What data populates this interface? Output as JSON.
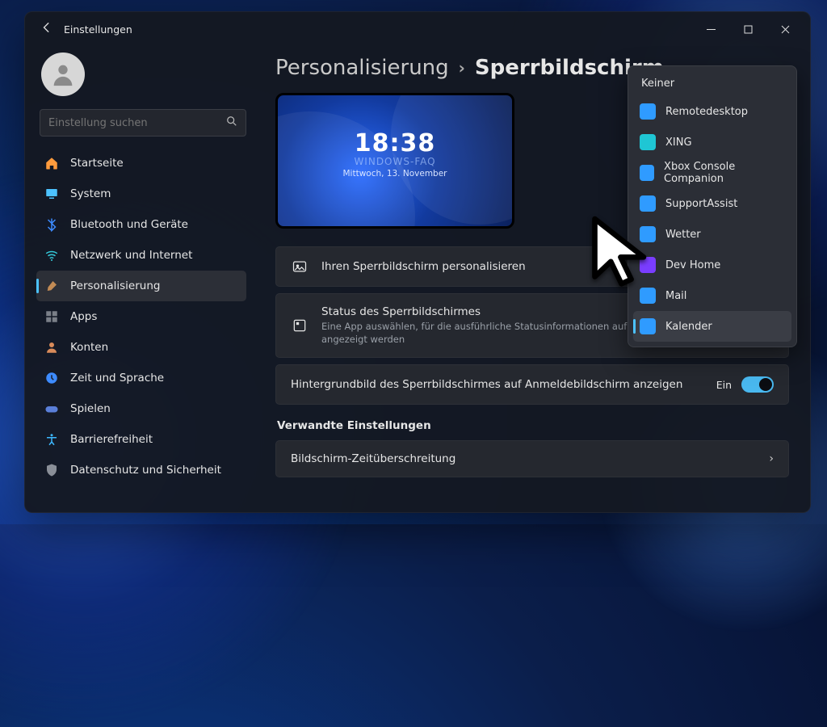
{
  "window": {
    "title": "Einstellungen"
  },
  "search": {
    "placeholder": "Einstellung suchen"
  },
  "nav": {
    "items": [
      {
        "label": "Startseite",
        "icon": "home",
        "color": "#ff9b3d"
      },
      {
        "label": "System",
        "icon": "system",
        "color": "#4cc2ff"
      },
      {
        "label": "Bluetooth und Geräte",
        "icon": "bluetooth",
        "color": "#3d8bff"
      },
      {
        "label": "Netzwerk und Internet",
        "icon": "wifi",
        "color": "#35c8d9"
      },
      {
        "label": "Personalisierung",
        "icon": "brush",
        "color": "#c28b55",
        "selected": true
      },
      {
        "label": "Apps",
        "icon": "apps",
        "color": "#7a7f88"
      },
      {
        "label": "Konten",
        "icon": "account",
        "color": "#d98b5a"
      },
      {
        "label": "Zeit und Sprache",
        "icon": "time",
        "color": "#3d8bff"
      },
      {
        "label": "Spielen",
        "icon": "game",
        "color": "#5a7fd9"
      },
      {
        "label": "Barrierefreiheit",
        "icon": "a11y",
        "color": "#3db8ff"
      },
      {
        "label": "Datenschutz und Sicherheit",
        "icon": "shield",
        "color": "#8a8f98"
      }
    ]
  },
  "breadcrumb": {
    "parent": "Personalisierung",
    "current": "Sperrbildschirm"
  },
  "preview": {
    "time": "18:38",
    "watermark": "WINDOWS-FAQ",
    "date": "Mittwoch, 13. November"
  },
  "cards": {
    "personalize": {
      "title": "Ihren Sperrbildschirm personalisieren"
    },
    "status": {
      "title": "Status des Sperrbildschirmes",
      "desc": "Eine App auswählen, für die ausführliche Statusinformationen auf dem Sperrbildschirm angezeigt werden"
    },
    "background_toggle": {
      "title": "Hintergrundbild des Sperrbildschirmes auf Anmeldebildschirm anzeigen",
      "state_label": "Ein",
      "state": true
    }
  },
  "related": {
    "heading": "Verwandte Einstellungen",
    "timeout": {
      "title": "Bildschirm-Zeitüberschreitung"
    }
  },
  "flyout": {
    "heading": "Keiner",
    "items": [
      {
        "label": "Remotedesktop",
        "color": "#2f9bff"
      },
      {
        "label": "XING",
        "color": "#1fc6d4"
      },
      {
        "label": "Xbox Console Companion",
        "color": "#2f9bff"
      },
      {
        "label": "SupportAssist",
        "color": "#2f9bff"
      },
      {
        "label": "Wetter",
        "color": "#2f9bff"
      },
      {
        "label": "Dev Home",
        "color": "#7a3dff"
      },
      {
        "label": "Mail",
        "color": "#2f9bff"
      },
      {
        "label": "Kalender",
        "color": "#2f9bff",
        "selected": true
      }
    ]
  }
}
